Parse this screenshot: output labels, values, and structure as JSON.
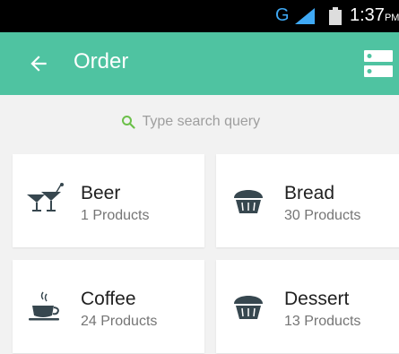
{
  "status_bar": {
    "network": "G",
    "time": "1:37",
    "ampm": "PM"
  },
  "app_bar": {
    "title": "Order",
    "color": "#4fc3a1"
  },
  "search": {
    "placeholder": "Type search query",
    "icon": "search-icon"
  },
  "categories": [
    {
      "name": "Beer",
      "count": "1 Products",
      "icon": "cocktail-glasses-icon"
    },
    {
      "name": "Bread",
      "count": "30 Products",
      "icon": "muffin-icon"
    },
    {
      "name": "Coffee",
      "count": "24 Products",
      "icon": "coffee-cup-icon"
    },
    {
      "name": "Dessert",
      "count": "13 Products",
      "icon": "muffin-icon"
    }
  ]
}
